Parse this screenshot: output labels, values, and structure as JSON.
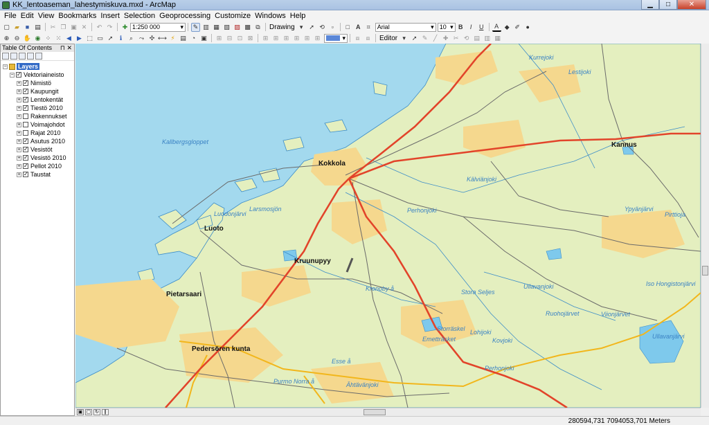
{
  "window": {
    "title": "KK_lentoaseman_lahestymiskuva.mxd - ArcMap"
  },
  "menu": [
    "File",
    "Edit",
    "View",
    "Bookmarks",
    "Insert",
    "Selection",
    "Geoprocessing",
    "Customize",
    "Windows",
    "Help"
  ],
  "toolbar": {
    "scale": "1:250 000",
    "drawing_label": "Drawing",
    "font": "Arial",
    "font_size": "10",
    "bold": "B",
    "italic": "I",
    "underline": "U",
    "editor_label": "Editor"
  },
  "toc": {
    "title": "Table Of Contents",
    "root": "Layers",
    "group": "Vektoriaineisto",
    "layers": [
      {
        "name": "Nimistö",
        "checked": true
      },
      {
        "name": "Kaupungit",
        "checked": true
      },
      {
        "name": "Lentokentät",
        "checked": true
      },
      {
        "name": "Tiestö 2010",
        "checked": true
      },
      {
        "name": "Rakennukset",
        "checked": false
      },
      {
        "name": "Voimajohdot",
        "checked": false
      },
      {
        "name": "Rajat 2010",
        "checked": false
      },
      {
        "name": "Asutus 2010",
        "checked": true
      },
      {
        "name": "Vesistöt",
        "checked": true
      },
      {
        "name": "Vesistö 2010",
        "checked": true
      },
      {
        "name": "Pellot 2010",
        "checked": true
      },
      {
        "name": "Taustat",
        "checked": true
      }
    ]
  },
  "map": {
    "towns": {
      "kokkola": "Kokkola",
      "kannus": "Kannus",
      "luoto": "Luoto",
      "kruunupyy": "Kruunupyy",
      "pietarsaari": "Pietarsaari",
      "pedersore": "Pedersören kunta"
    },
    "water": {
      "kalvianjoki": "Kälviänjoki",
      "lestijoki": "Lestijoki",
      "kurrejoki": "Kurrejoki",
      "kallbergsgloppet": "Kallbergsgloppet",
      "perhonjoki1": "Perhonjoki",
      "perhonjoki2": "Perhonjoki",
      "ypyanjarvi": "Ypyänjärvi",
      "pirttioja": "Pirttioja",
      "larsmosjon": "Larsmosjön",
      "luodonjarvi": "Luodonjärvi",
      "ullavanjoki": "Ullavanjoki",
      "stora_seljes": "Stora Seljes",
      "isohongiston": "Iso Hongistonjärvi",
      "kronoby": "Kronoby å",
      "ruohojarvet": "Ruohojärvet",
      "vionjarvet": "Viionjärvet",
      "ullavanjarvi": "Ullavanjärvi",
      "storraskel": "Storräskel",
      "emetraskel": "Emetträsket",
      "kovjoki": "Kovjoki",
      "esse": "Esse å",
      "ahtavanjoki": "Ähtävänjoki",
      "purmo": "Purmo Norra å",
      "lohijoki": "Lohijoki"
    },
    "colors": {
      "sea": "#a3d9ee",
      "land": "#e4efbf",
      "urban": "#f5d88e",
      "road_main": "#e2442a",
      "road_yellow": "#f2b61b",
      "road_minor": "#6a6a6a",
      "lake": "#7ec9ec"
    }
  },
  "status": {
    "coordinates": "280594,731  7094053,701 Meters"
  }
}
